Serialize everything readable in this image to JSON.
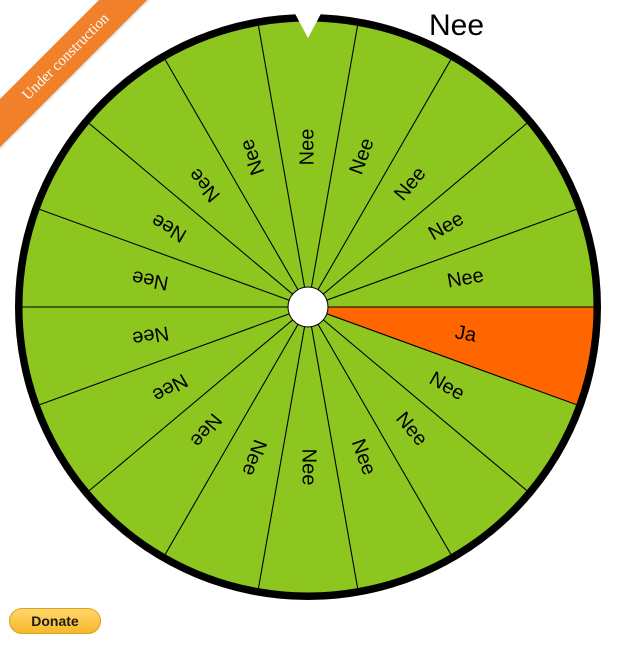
{
  "banner": {
    "text": "Under construction",
    "color": "#f0812a"
  },
  "result": {
    "text": "Nee"
  },
  "wheel": {
    "rim_color": "#000000",
    "default_color": "#8cc61f",
    "highlight_color": "#ff6600",
    "segments": [
      {
        "label": "Nee",
        "color": "#8cc61f"
      },
      {
        "label": "Nee",
        "color": "#8cc61f"
      },
      {
        "label": "Nee",
        "color": "#8cc61f"
      },
      {
        "label": "Nee",
        "color": "#8cc61f"
      },
      {
        "label": "Nee",
        "color": "#8cc61f"
      },
      {
        "label": "Ja",
        "color": "#ff6600"
      },
      {
        "label": "Nee",
        "color": "#8cc61f"
      },
      {
        "label": "Nee",
        "color": "#8cc61f"
      },
      {
        "label": "Nee",
        "color": "#8cc61f"
      },
      {
        "label": "Nee",
        "color": "#8cc61f"
      },
      {
        "label": "Nee",
        "color": "#8cc61f"
      },
      {
        "label": "Nee",
        "color": "#8cc61f"
      },
      {
        "label": "Nee",
        "color": "#8cc61f"
      },
      {
        "label": "Nee",
        "color": "#8cc61f"
      },
      {
        "label": "Nee",
        "color": "#8cc61f"
      },
      {
        "label": "Nee",
        "color": "#8cc61f"
      },
      {
        "label": "Nee",
        "color": "#8cc61f"
      },
      {
        "label": "Nee",
        "color": "#8cc61f"
      }
    ],
    "pointer_icon": "pointer-triangle-icon",
    "hub_icon": "wheel-hub-icon"
  },
  "donate": {
    "label": "Donate"
  }
}
